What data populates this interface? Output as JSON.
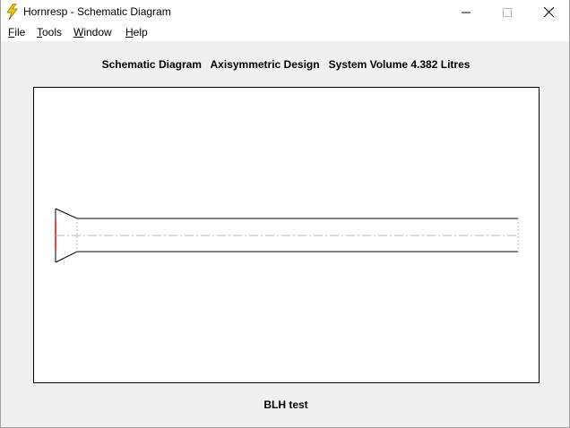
{
  "window": {
    "title": "Hornresp - Schematic Diagram",
    "controls": {
      "minimize": "—",
      "maximize": "☐",
      "close": "✕"
    }
  },
  "app_icon": "lightning-bolt-icon",
  "menu": [
    {
      "label": "File",
      "accel": "F",
      "rest": "ile"
    },
    {
      "label": "Tools",
      "accel": "T",
      "rest": "ools"
    },
    {
      "label": "Window",
      "accel": "W",
      "rest": "indow"
    },
    {
      "label": "Help",
      "accel": "H",
      "rest": "elp"
    }
  ],
  "diagram": {
    "heading": "Schematic Diagram   Axisymmetric Design   System Volume 4.382 Litres",
    "caption": "BLH test"
  },
  "colors": {
    "outline": "#000000",
    "driver": "#ff0000",
    "centerline": "#b4b4b4",
    "icon_fill": "#f5d000"
  }
}
